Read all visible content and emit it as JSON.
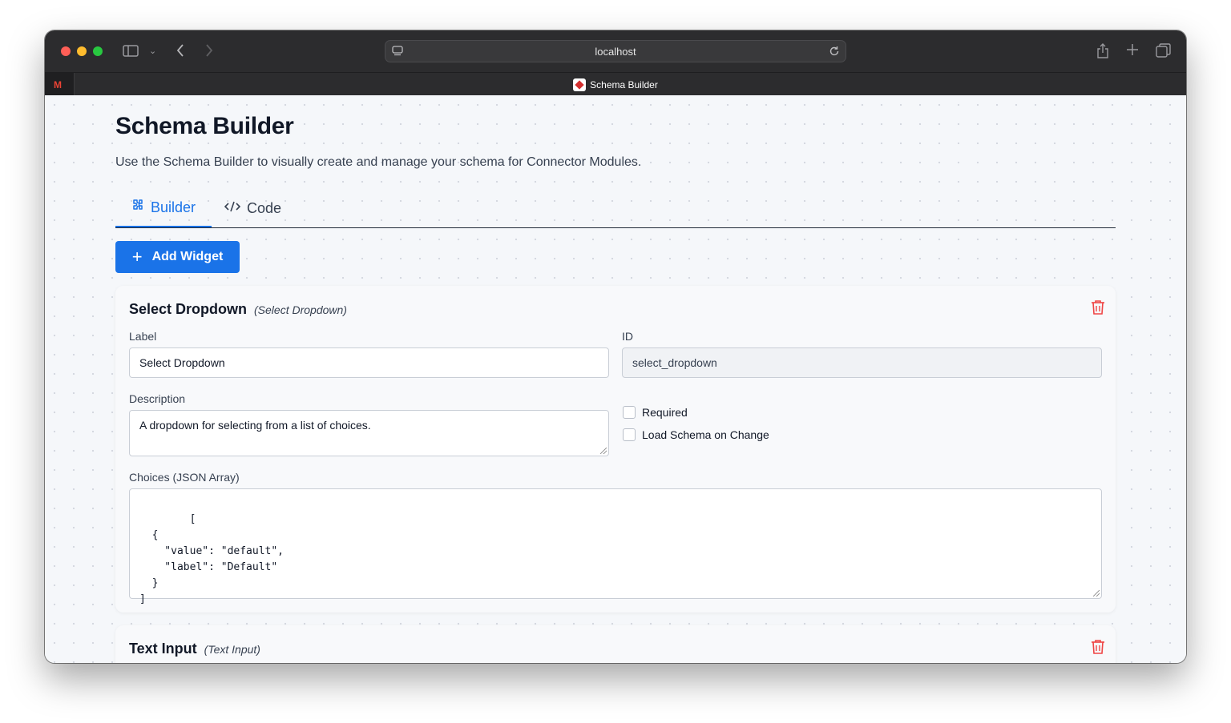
{
  "browser": {
    "url": "localhost",
    "tab_title": "Schema Builder"
  },
  "page": {
    "title": "Schema Builder",
    "description": "Use the Schema Builder to visually create and manage your schema for Connector Modules."
  },
  "tabs": [
    {
      "label": "Builder",
      "icon": "puzzle-icon",
      "active": true
    },
    {
      "label": "Code",
      "icon": "code-icon",
      "active": false
    }
  ],
  "add_widget": {
    "label": "Add Widget"
  },
  "widgets": [
    {
      "title": "Select Dropdown",
      "type": "(Select Dropdown)",
      "label_label": "Label",
      "label_value": "Select Dropdown",
      "id_label": "ID",
      "id_value": "select_dropdown",
      "description_label": "Description",
      "description_value": "A dropdown for selecting from a list of choices.",
      "required_label": "Required",
      "load_schema_label": "Load Schema on Change",
      "choices_label": "Choices (JSON Array)",
      "choices_value": "[\n  {\n    \"value\": \"default\",\n    \"label\": \"Default\"\n  }\n]"
    },
    {
      "title": "Text Input",
      "type": "(Text Input)"
    }
  ],
  "colors": {
    "accent": "#1a73e8",
    "delete": "#ef4444"
  }
}
